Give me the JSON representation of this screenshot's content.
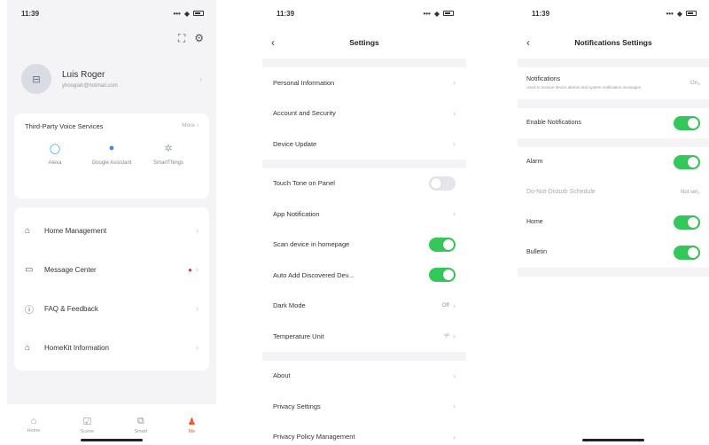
{
  "status": {
    "time": "11:39"
  },
  "screen1": {
    "profile": {
      "name": "Luis Roger",
      "email": "yhoogiah@hotmail.com"
    },
    "voice": {
      "title": "Third-Party Voice Services",
      "more": "More",
      "items": [
        {
          "label": "Alexa",
          "icon": "alexa-icon"
        },
        {
          "label": "Google Assistant",
          "icon": "google-assistant-icon"
        },
        {
          "label": "SmartThings",
          "icon": "smartthings-icon"
        }
      ]
    },
    "menu": [
      {
        "label": "Home Management",
        "icon": "home-icon"
      },
      {
        "label": "Message Center",
        "icon": "message-icon"
      },
      {
        "label": "FAQ & Feedback",
        "icon": "help-icon"
      },
      {
        "label": "HomeKit Information",
        "icon": "homekit-icon"
      }
    ],
    "tabs": [
      {
        "label": "Home"
      },
      {
        "label": "Scene"
      },
      {
        "label": "Smart"
      },
      {
        "label": "Me"
      }
    ],
    "accent": "#ef5a28"
  },
  "screen2": {
    "title": "Settings",
    "group1": [
      {
        "label": "Personal Information"
      },
      {
        "label": "Account and Security"
      },
      {
        "label": "Device Update"
      }
    ],
    "group2": [
      {
        "label": "Touch Tone on Panel",
        "toggle": "off"
      },
      {
        "label": "App Notification"
      },
      {
        "label": "Scan device in homepage",
        "toggle": "on"
      },
      {
        "label": "Auto Add Discovered Dev...",
        "toggle": "on"
      },
      {
        "label": "Dark Mode",
        "value": "Off"
      },
      {
        "label": "Temperature Unit",
        "value": "°F"
      }
    ],
    "group3": [
      {
        "label": "About"
      },
      {
        "label": "Privacy Settings"
      },
      {
        "label": "Privacy Policy Management"
      }
    ]
  },
  "screen3": {
    "title": "Notifications Settings",
    "notifications": {
      "label": "Notifications",
      "desc": "Used to receive device alarms and system notification messages",
      "value": "On"
    },
    "enable": "Enable Notifications",
    "alarm": "Alarm",
    "dnd": {
      "label": "Do-Not-Disturb Schedule",
      "value": "Not set"
    },
    "home": "Home",
    "bulletin": "Bulletin",
    "toggle_color": "#34c759"
  }
}
